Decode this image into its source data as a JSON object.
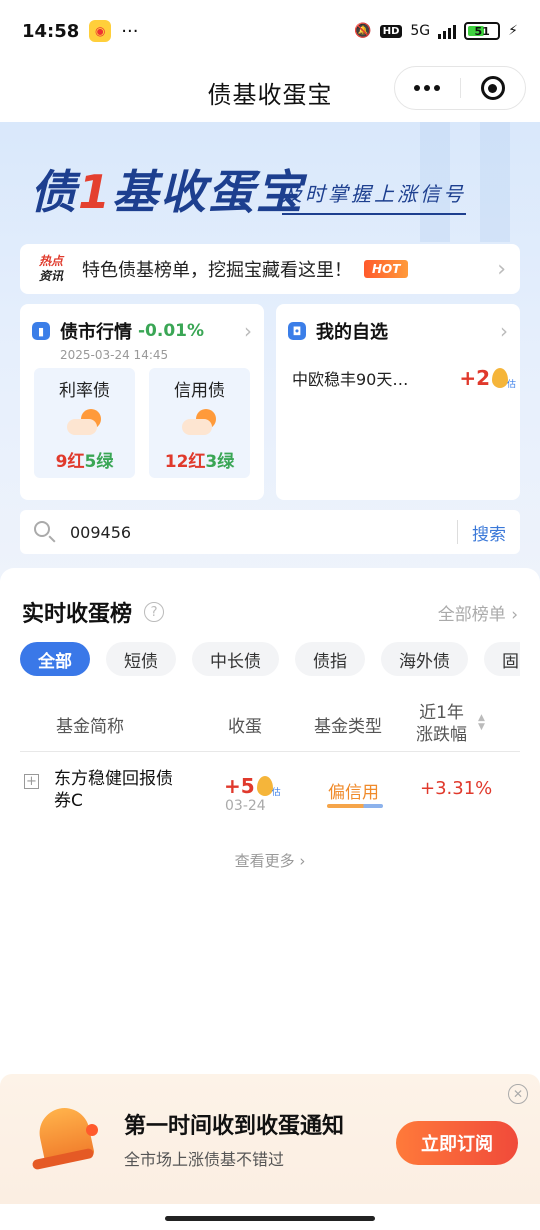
{
  "status_bar": {
    "time": "14:58",
    "more": "···",
    "network": "5G",
    "battery": "51"
  },
  "titlebar": {
    "title": "债基收蛋宝"
  },
  "hero": {
    "brand_a": "债",
    "brand_one": "1",
    "brand_b": "基收蛋宝",
    "slogan": "及时掌握上涨信号",
    "hot": {
      "tag_top": "热点",
      "tag_bottom": "资讯",
      "text": "特色债基榜单，挖掘宝藏看这里！",
      "badge": "HOT"
    }
  },
  "market_card": {
    "title": "债市行情",
    "change": "-0.01%",
    "date": "2025-03-24 14:45",
    "tiles": [
      {
        "name": "利率债",
        "red": "9红",
        "green": "5绿"
      },
      {
        "name": "信用债",
        "red": "12红",
        "green": "3绿"
      }
    ]
  },
  "fav_card": {
    "title": "我的自选",
    "fund": "中欧稳丰90天…",
    "value": "+2",
    "egg_tag": "估"
  },
  "search": {
    "value": "009456",
    "button": "搜索"
  },
  "ranking": {
    "title": "实时收蛋榜",
    "all_label": "全部榜单 ›",
    "tabs": [
      "全部",
      "短债",
      "中长债",
      "债指",
      "海外债",
      "固收+"
    ],
    "headers": {
      "name": "基金简称",
      "egg": "收蛋",
      "type": "基金类型",
      "change_1": "近1年",
      "change_2": "涨跌幅"
    },
    "rows": [
      {
        "name": "东方稳健回报债券C",
        "egg": "+5",
        "egg_tag": "估",
        "date": "03-24",
        "type": "偏信用",
        "change": "+3.31%"
      }
    ],
    "more": "查看更多 ›"
  },
  "subscribe": {
    "title": "第一时间收到收蛋通知",
    "desc": "全市场上涨债基不错过",
    "button": "立即订阅"
  },
  "colors": {
    "accent": "#3a78e8",
    "up": "#e0392c",
    "down": "#3aa655",
    "brand": "#1d3f8f"
  }
}
